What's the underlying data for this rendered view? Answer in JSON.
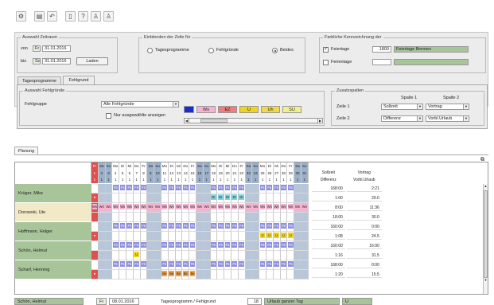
{
  "toolbar": {
    "icons": [
      "filter-icon",
      "save-icon",
      "undo-icon",
      "document-icon",
      "help-pointer-icon",
      "person-list-icon",
      "person-report-icon"
    ]
  },
  "period": {
    "title": "Auswahl Zeitraum",
    "from_label": "von",
    "from_day": "Fr",
    "from_date": "31.01.2016",
    "to_label": "bis",
    "to_day": "So",
    "to_date": "31.01.2016",
    "load_label": "Laden"
  },
  "display": {
    "title": "Einblenden der Zeile für",
    "options": [
      "Tagesprogramme",
      "Fehlgründe",
      "Beides"
    ],
    "selected": 2
  },
  "marking": {
    "title": "Farbliche Kennzeichnung der",
    "holiday_label": "Feiertage",
    "holiday_checked": true,
    "holiday_code": "1800",
    "holiday_name": "Feiertage Bremen",
    "vacation_label": "Ferientage",
    "vacation_checked": false,
    "vacation_color": "#a8c59a"
  },
  "tabs": [
    "Tagesprogramme",
    "Fehlgrund"
  ],
  "active_tab": 1,
  "reason": {
    "title": "Auswahl Fehlgründe",
    "group_label": "Fehlgruppe",
    "group_value": "Alle Fehlgründe",
    "only_selected_label": "Nur ausgewählte anzeigen",
    "legend": [
      {
        "code": "",
        "color": "#1a2cd1"
      },
      {
        "code": "Ws",
        "color": "#f5b3d2"
      },
      {
        "code": "EZ",
        "color": "#f17a7a"
      },
      {
        "code": "U",
        "color": "#f1d31a"
      },
      {
        "code": "Uh",
        "color": "#f2d847"
      },
      {
        "code": "SU",
        "color": "#f3ef8f"
      }
    ]
  },
  "extra": {
    "title": "Zusatzspalten",
    "col1_header": "Spalte 1",
    "col2_header": "Spalte 2",
    "row1_label": "Zeile 1",
    "row2_label": "Zeile 2",
    "row1_col1": "Sollzeit",
    "row1_col2": "Vortrag",
    "row2_col1": "Differenz",
    "row2_col2": "Vorbl.Urlaub"
  },
  "planning_tab": "Planung",
  "calendar": {
    "weekdays": [
      "Fr",
      "Sa",
      "So",
      "Mo",
      "Di",
      "Mi",
      "Do",
      "Fr",
      "Sa",
      "So",
      "Mo",
      "Di",
      "Mi",
      "Do",
      "Fr",
      "Sa",
      "So",
      "Mo",
      "Di",
      "Mi",
      "Do",
      "Fr",
      "Sa",
      "So",
      "Mo",
      "Di",
      "Mi",
      "Do",
      "Fr",
      "Sa",
      "So"
    ],
    "days": [
      "1",
      "2",
      "3",
      "4",
      "5",
      "6",
      "7",
      "8",
      "9",
      "10",
      "11",
      "12",
      "13",
      "14",
      "15",
      "16",
      "17",
      "18",
      "19",
      "20",
      "21",
      "22",
      "23",
      "24",
      "25",
      "26",
      "27",
      "28",
      "29",
      "30",
      "31"
    ],
    "counts": [
      "1",
      "1",
      "1",
      "1",
      "1",
      "1",
      "1",
      "1",
      "1",
      "1",
      "1",
      "1",
      "1",
      "1",
      "1",
      "1",
      "1",
      "1",
      "1",
      "1",
      "1",
      "1",
      "1",
      "1",
      "1",
      "1",
      "1",
      "1",
      "1",
      "1",
      "1"
    ],
    "weekend_days": [
      2,
      3,
      9,
      10,
      16,
      17,
      23,
      24,
      30,
      31
    ],
    "holiday_days": [
      1
    ],
    "sum_header_a": "Sollzeit",
    "sum_header_b": "Vortrag",
    "sum_sub_a": "Differenz",
    "sum_sub_b": "Vorbl.Urlaub"
  },
  "employees": [
    {
      "name": "Krüger, Mike",
      "top": [
        "F5",
        "F5",
        "F5",
        "F5",
        "F5"
      ],
      "bottom": [
        "Dr",
        "Dr",
        "Dr",
        "Dr",
        "Dr"
      ],
      "bottom_color": "#7fd3e0",
      "bottom_week": 2,
      "s1": "168:00",
      "s2": "2:21",
      "s3": "1:00",
      "s4": "29.0"
    },
    {
      "name": "Dorowski, Ute",
      "top": [
        "Ws",
        "Ws",
        "Ws",
        "Ws",
        "Ws"
      ],
      "bottom": [],
      "bottom_color": "",
      "bottom_week": -1,
      "s1": "8:00",
      "s2": "11:36",
      "s3": "18:00",
      "s4": "30.0"
    },
    {
      "name": "Hoffmann, Holger",
      "top": [
        "F5",
        "F5",
        "F5",
        "F5",
        "F5"
      ],
      "bottom": [
        "U",
        "U",
        "U",
        "U",
        "U"
      ],
      "bottom_color": "#f2d221",
      "bottom_week": 3,
      "s1": "160:00",
      "s2": "0:00",
      "s3": "1:08",
      "s4": "24.5"
    },
    {
      "name": "Schön, Helmut",
      "top": [
        "F5",
        "F5",
        "F5",
        "F5",
        "F5"
      ],
      "bottom": [
        "U"
      ],
      "bottom_color": "#f2d221",
      "bottom_week": 0,
      "s1": "160:00",
      "s2": "16:00",
      "s3": "1:16",
      "s4": "31.5"
    },
    {
      "name": "Scharf, Henning",
      "top": [
        "F5",
        "F5",
        "F5",
        "F5",
        "F5"
      ],
      "bottom": [
        "Be",
        "Be",
        "Be",
        "Be",
        "Be"
      ],
      "bottom_color": "#f2a24a",
      "bottom_week": 1,
      "s1": "168:00",
      "s2": "0:00",
      "s3": "1:20",
      "s4": "15.5"
    }
  ],
  "status": {
    "name": "Schön, Helmut",
    "day": "Fr",
    "date": "08.01.2016",
    "type": "Tagesprogramm / Fehlgrund",
    "code": "18",
    "desc": "Urlaub ganzer Tag",
    "short": "U"
  }
}
